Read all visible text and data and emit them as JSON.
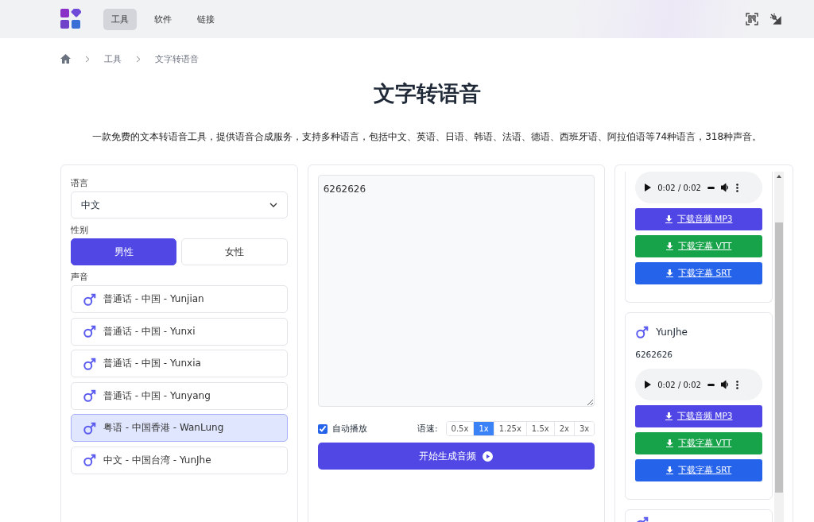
{
  "nav": {
    "items": [
      {
        "label": "工具",
        "selected": true
      },
      {
        "label": "软件",
        "selected": false
      },
      {
        "label": "链接",
        "selected": false
      }
    ]
  },
  "breadcrumb": [
    "工具",
    "文字转语音"
  ],
  "title": "文字转语音",
  "subtitle": "一款免费的文本转语音工具，提供语音合成服务，支持多种语言，包括中文、英语、日语、韩语、法语、德语、西班牙语、阿拉伯语等74种语言，318种声音。",
  "settings": {
    "language_label": "语言",
    "language": "中文",
    "gender_label": "性别",
    "genders": [
      {
        "label": "男性",
        "selected": true
      },
      {
        "label": "女性",
        "selected": false
      }
    ],
    "voice_label": "声音",
    "voices": [
      {
        "label": "普通话 - 中国 - Yunjian",
        "selected": false
      },
      {
        "label": "普通话 - 中国 - Yunxi",
        "selected": false
      },
      {
        "label": "普通话 - 中国 - Yunxia",
        "selected": false
      },
      {
        "label": "普通话 - 中国 - Yunyang",
        "selected": false
      },
      {
        "label": "粤语 - 中国香港 - WanLung",
        "selected": true
      },
      {
        "label": "中文 - 中国台湾 - YunJhe",
        "selected": false
      }
    ]
  },
  "editor": {
    "text": "6262626",
    "autoplay_label": "自动播放",
    "autoplay": true,
    "speed_label": "语速:",
    "speeds": [
      {
        "label": "0.5x",
        "selected": false
      },
      {
        "label": "1x",
        "selected": true
      },
      {
        "label": "1.25x",
        "selected": false
      },
      {
        "label": "1.5x",
        "selected": false
      },
      {
        "label": "2x",
        "selected": false
      },
      {
        "label": "3x",
        "selected": false
      }
    ],
    "generate_button": "开始生成音频"
  },
  "results": [
    {
      "time": "0:02 / 0:02",
      "downloads": [
        {
          "kind": "mp3",
          "label": "下载音频 MP3"
        },
        {
          "kind": "vtt",
          "label": "下载字幕 VTT"
        },
        {
          "kind": "srt",
          "label": "下载字幕 SRT"
        }
      ]
    },
    {
      "name": "YunJhe",
      "text": "6262626",
      "time": "0:02 / 0:02",
      "downloads": [
        {
          "kind": "mp3",
          "label": "下载音频 MP3"
        },
        {
          "kind": "vtt",
          "label": "下载字幕 VTT"
        },
        {
          "kind": "srt",
          "label": "下载字幕 SRT"
        }
      ]
    },
    {
      "kind": "partial"
    }
  ]
}
